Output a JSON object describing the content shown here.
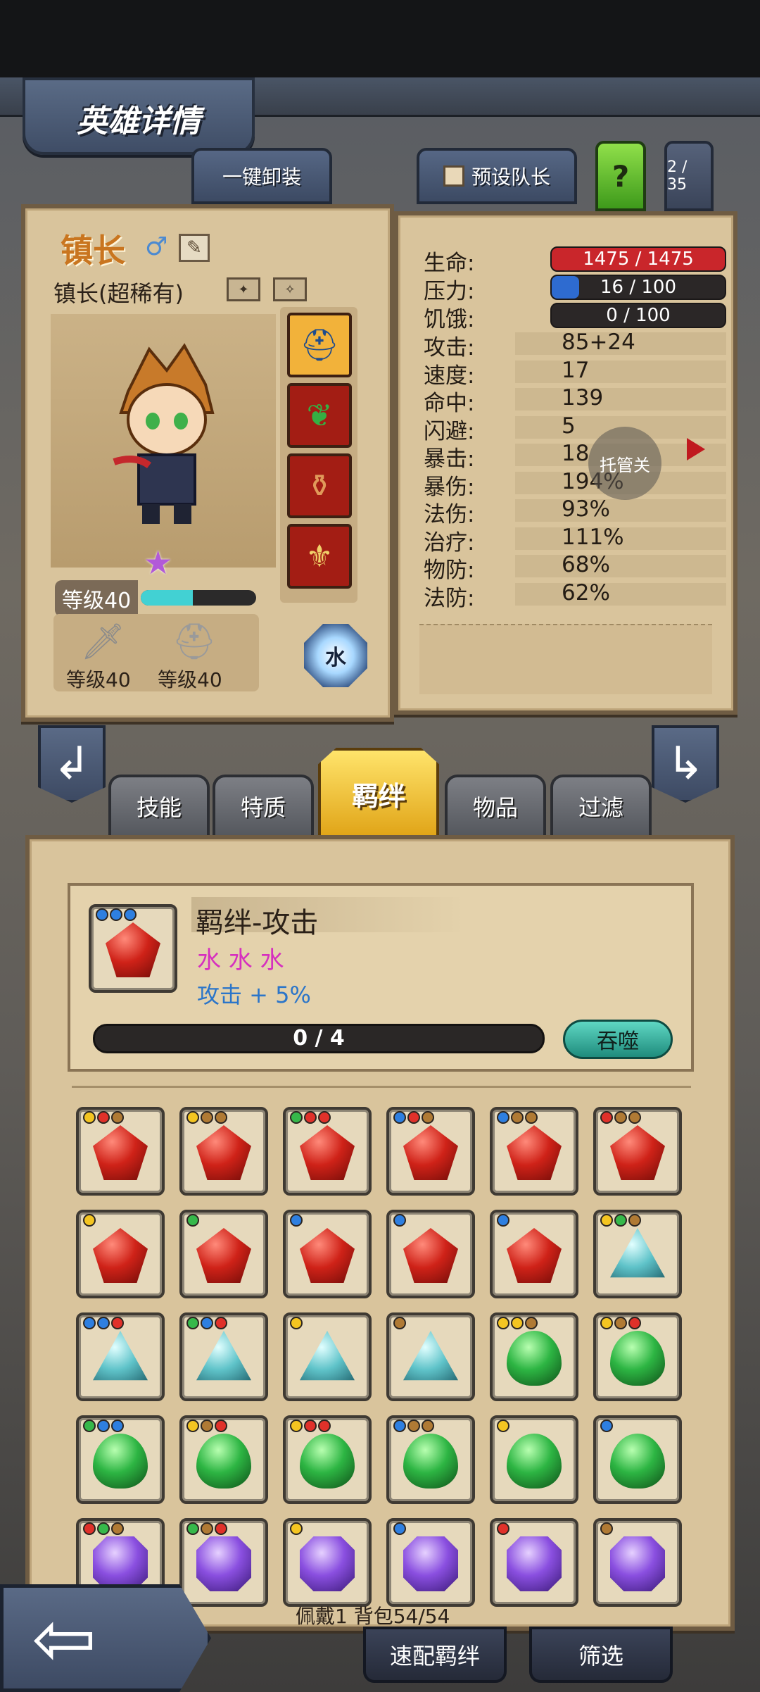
{
  "header": {
    "title": "英雄详情"
  },
  "top_buttons": {
    "unequip_all": "一键卸装",
    "preset_leader": "预设队长",
    "help": "?",
    "page": "2 / 35"
  },
  "hero": {
    "name": "镇长",
    "subtitle": "镇长(超稀有)",
    "level": "等级40",
    "xp_fraction": 0.45,
    "weapon_level": "等级40",
    "armor_level": "等级40",
    "element": "水"
  },
  "stats": {
    "hp": {
      "label": "生命:",
      "value": "1475 / 1475",
      "fraction": 1.0
    },
    "stress": {
      "label": "压力:",
      "value": "16 / 100",
      "fraction": 0.16
    },
    "hunger": {
      "label": "饥饿:",
      "value": "0 / 100",
      "fraction": 0
    },
    "rows": [
      {
        "label": "攻击:",
        "value": "85+24"
      },
      {
        "label": "速度:",
        "value": "17"
      },
      {
        "label": "命中:",
        "value": "139"
      },
      {
        "label": "闪避:",
        "value": "5"
      },
      {
        "label": "暴击:",
        "value": "18"
      },
      {
        "label": "暴伤:",
        "value": "194%"
      },
      {
        "label": "法伤:",
        "value": "93%"
      },
      {
        "label": "治疗:",
        "value": "111%"
      },
      {
        "label": "物防:",
        "value": "68%"
      },
      {
        "label": "法防:",
        "value": "62%"
      }
    ],
    "host_button": "托管关"
  },
  "tabs": [
    "技能",
    "特质",
    "羁绊",
    "物品",
    "过滤"
  ],
  "bond": {
    "title": "羁绊-攻击",
    "requirement": "水 水 水",
    "bonus": "攻击 + 5%",
    "progress": "0 / 4",
    "devour_label": "吞噬"
  },
  "colors": {
    "blue": "#2e7fe0",
    "red": "#e0312a",
    "yellow": "#f4c521",
    "green": "#36b84a",
    "brown": "#b07a34"
  },
  "inventory": [
    {
      "gem": "red",
      "dots": [
        "yellow",
        "red",
        "brown"
      ]
    },
    {
      "gem": "red",
      "dots": [
        "yellow",
        "brown",
        "brown"
      ]
    },
    {
      "gem": "red",
      "dots": [
        "green",
        "red",
        "red"
      ]
    },
    {
      "gem": "red",
      "dots": [
        "blue",
        "red",
        "brown"
      ]
    },
    {
      "gem": "red",
      "dots": [
        "blue",
        "brown",
        "brown"
      ]
    },
    {
      "gem": "red",
      "dots": [
        "red",
        "brown",
        "brown"
      ]
    },
    {
      "gem": "red",
      "dots": [
        "yellow"
      ]
    },
    {
      "gem": "red",
      "dots": [
        "green"
      ]
    },
    {
      "gem": "red",
      "dots": [
        "blue"
      ]
    },
    {
      "gem": "red",
      "dots": [
        "blue"
      ]
    },
    {
      "gem": "red",
      "dots": [
        "blue"
      ]
    },
    {
      "gem": "cyan",
      "dots": [
        "yellow",
        "green",
        "brown"
      ]
    },
    {
      "gem": "cyan",
      "dots": [
        "blue",
        "blue",
        "red"
      ]
    },
    {
      "gem": "cyan",
      "dots": [
        "green",
        "blue",
        "red"
      ]
    },
    {
      "gem": "cyan",
      "dots": [
        "yellow"
      ]
    },
    {
      "gem": "cyan",
      "dots": [
        "brown"
      ]
    },
    {
      "gem": "green",
      "dots": [
        "yellow",
        "yellow",
        "brown"
      ]
    },
    {
      "gem": "green",
      "dots": [
        "yellow",
        "brown",
        "red"
      ]
    },
    {
      "gem": "green",
      "dots": [
        "green",
        "blue",
        "blue"
      ]
    },
    {
      "gem": "green",
      "dots": [
        "yellow",
        "brown",
        "red"
      ]
    },
    {
      "gem": "green",
      "dots": [
        "yellow",
        "red",
        "red"
      ]
    },
    {
      "gem": "green",
      "dots": [
        "blue",
        "brown",
        "brown"
      ]
    },
    {
      "gem": "green",
      "dots": [
        "yellow"
      ]
    },
    {
      "gem": "green",
      "dots": [
        "blue"
      ]
    },
    {
      "gem": "purple",
      "dots": [
        "red",
        "green",
        "brown"
      ]
    },
    {
      "gem": "purple",
      "dots": [
        "green",
        "brown",
        "red"
      ]
    },
    {
      "gem": "purple",
      "dots": [
        "yellow"
      ]
    },
    {
      "gem": "purple",
      "dots": [
        "blue"
      ]
    },
    {
      "gem": "purple",
      "dots": [
        "red"
      ]
    },
    {
      "gem": "purple",
      "dots": [
        "brown"
      ]
    }
  ],
  "footer": {
    "info": "佩戴1 背包54/54",
    "quick_bond": "速配羁绊",
    "filter": "筛选"
  }
}
